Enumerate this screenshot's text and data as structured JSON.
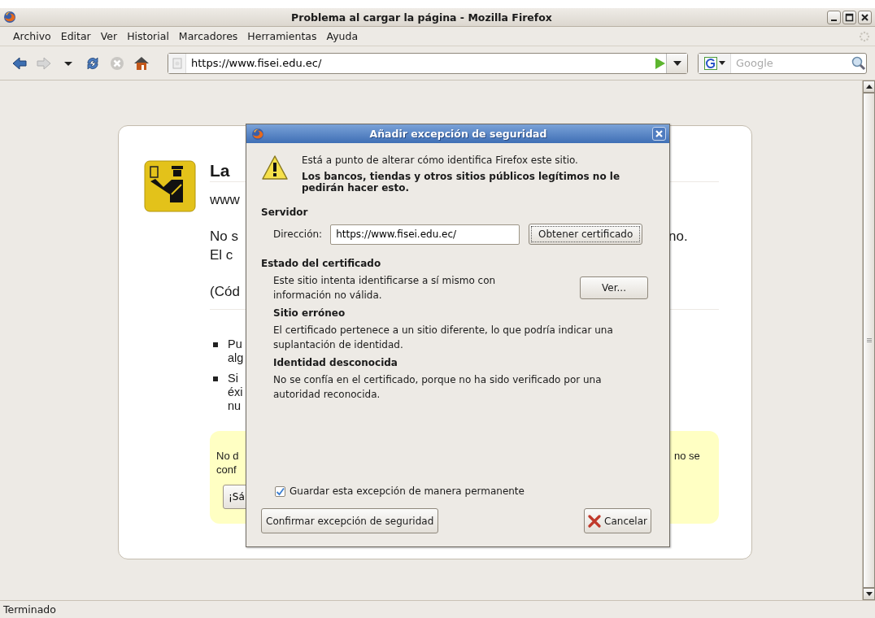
{
  "window": {
    "title": "Problema al cargar la página - Mozilla Firefox"
  },
  "menu": [
    {
      "label": "Archivo"
    },
    {
      "label": "Editar"
    },
    {
      "label": "Ver"
    },
    {
      "label": "Historial"
    },
    {
      "label": "Marcadores"
    },
    {
      "label": "Herramientas"
    },
    {
      "label": "Ayuda"
    }
  ],
  "toolbar": {
    "buttons": [
      {
        "kind": "back",
        "disabled": false
      },
      {
        "kind": "forward",
        "disabled": true
      },
      {
        "kind": "history",
        "disabled": false
      },
      {
        "kind": "reload",
        "disabled": false
      },
      {
        "kind": "stop",
        "disabled": true
      },
      {
        "kind": "home",
        "disabled": false
      }
    ],
    "url": "https://www.fisei.edu.ec/",
    "search_placeholder": "Google"
  },
  "error_page": {
    "heading": "La",
    "url_fragment": "www",
    "lines": [
      {
        "left": "No s",
        "right": "no."
      },
      {
        "left": "El c"
      }
    ],
    "code_fragment": "(Cód",
    "bullets": [
      [
        "Pu",
        "alg"
      ],
      [
        "Si",
        "éxi",
        "nu"
      ]
    ],
    "warning": {
      "lines": [
        {
          "left": "No d",
          "right": "no se"
        },
        {
          "left": "conf"
        }
      ],
      "button": "¡Sá"
    }
  },
  "dialog": {
    "title": "Añadir excepción de seguridad",
    "intro": "Está a punto de alterar cómo identifica Firefox este sitio.",
    "warning": "Los bancos, tiendas y otros sitios públicos legítimos no le pedirán hacer esto.",
    "server": {
      "heading": "Servidor",
      "label": "Dirección:",
      "value": "https://www.fisei.edu.ec/",
      "button": {
        "label": "Obtener certificado"
      }
    },
    "status": {
      "heading": "Estado del certificado",
      "text": "Este sitio intenta identificarse a sí mismo con información no válida.",
      "button": {
        "label": "Ver..."
      },
      "problems": [
        {
          "heading": "Sitio erróneo",
          "text": "El certificado pertenece a un sitio diferente, lo que podría indicar una suplantación de identidad."
        },
        {
          "heading": "Identidad desconocida",
          "text": "No se confía en el certificado, porque no ha sido verificado por una autoridad reconocida."
        }
      ]
    },
    "permanent": {
      "label": "Guardar esta excepción de manera permanente",
      "checked": true
    },
    "buttons": [
      {
        "kind": "confirm",
        "label": "Confirmar excepción de seguridad"
      },
      {
        "kind": "cancel",
        "label": "Cancelar"
      }
    ]
  },
  "status_bar": "Terminado"
}
